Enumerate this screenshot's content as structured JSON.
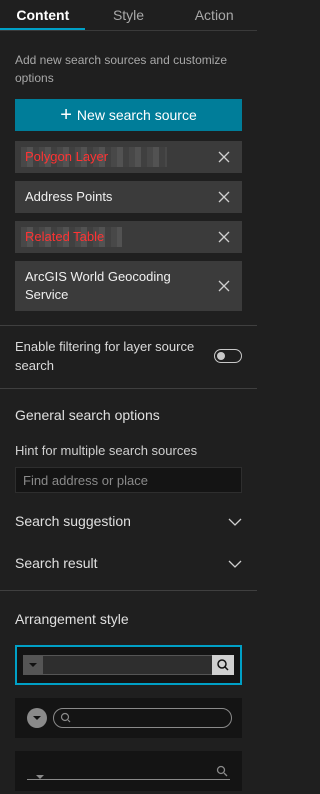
{
  "tabs": [
    {
      "label": "Content"
    },
    {
      "label": "Style"
    },
    {
      "label": "Action"
    }
  ],
  "content": {
    "description": "Add new search sources and customize options",
    "new_source_button": "New search source",
    "sources": [
      {
        "label": "Polygon Layer"
      },
      {
        "label": "Address Points"
      },
      {
        "label": "Related Table"
      },
      {
        "label": "ArcGIS World Geocoding Service"
      }
    ],
    "filter_toggle": {
      "label": "Enable filtering for layer source search",
      "enabled": false
    },
    "general": {
      "title": "General search options",
      "hint_label": "Hint for multiple search sources",
      "hint_placeholder": "Find address or place",
      "suggestion_label": "Search suggestion",
      "result_label": "Search result"
    },
    "arrangement": {
      "title": "Arrangement style",
      "selected_index": 0
    }
  },
  "colors": {
    "accent": "#00a0c6",
    "primary_button": "#007d99",
    "highlight_text": "#ff3333"
  }
}
